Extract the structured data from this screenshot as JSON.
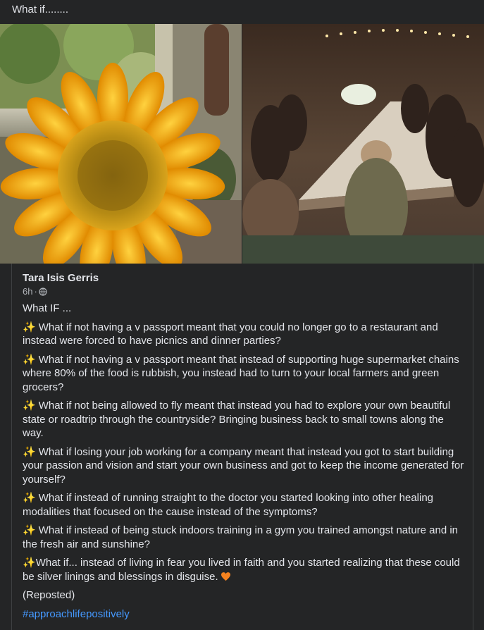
{
  "post": {
    "text": "What if........"
  },
  "photos": [
    {
      "name": "sunflower-photo"
    },
    {
      "name": "dinner-party-photo"
    }
  ],
  "shared_post": {
    "author": "Tara Isis Gerris",
    "time": "6h",
    "separator": "·",
    "privacy_icon": "globe-icon",
    "intro": "What IF ...",
    "items": [
      {
        "icon": "sparkles-emoji",
        "text": "What if not having a v passport meant that you could no longer go to a restaurant and instead were forced to have picnics and dinner parties?"
      },
      {
        "icon": "sparkles-emoji",
        "text": "What if not having a v passport meant that instead of supporting huge supermarket chains where 80% of the food is rubbish, you instead had to turn to your local farmers and green grocers?"
      },
      {
        "icon": "sparkles-emoji",
        "text": "What if not being allowed to fly meant that instead you had to explore your own beautiful state or roadtrip through the countryside? Bringing business back to small towns along the way."
      },
      {
        "icon": "sparkles-emoji",
        "text": "What if losing your job working for a company meant that instead you got to start building your passion and vision and start your own business and got to keep the income generated for yourself?"
      },
      {
        "icon": "sparkles-emoji",
        "text": "What if instead of running straight to the doctor you started looking into other healing modalities that focused on the cause instead of the symptoms?"
      },
      {
        "icon": "sparkles-emoji",
        "text": "What if instead of being stuck indoors training in a gym you trained amongst nature and in the fresh air and sunshine?"
      },
      {
        "icon": "sparkles-emoji",
        "text": "What if... instead of living in fear you lived in faith and you started realizing that these could be silver linings and blessings in disguise."
      }
    ],
    "reposted": "(Reposted)",
    "hashtag": "#approachlifepositively",
    "heart_emoji": "orange-heart-emoji",
    "colors": {
      "hashtag": "#4599ff",
      "background": "#242526"
    }
  }
}
